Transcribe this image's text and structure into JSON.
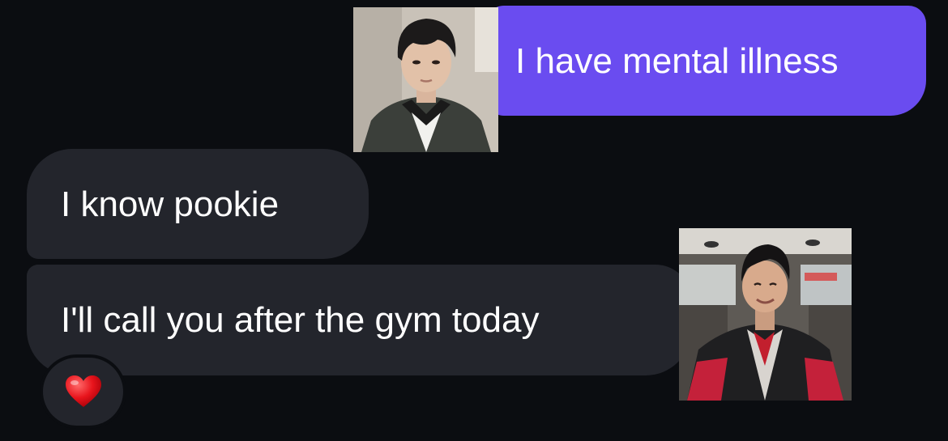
{
  "messages": [
    {
      "direction": "outgoing",
      "text": "I have mental illness"
    },
    {
      "direction": "incoming",
      "text": "I know pookie"
    },
    {
      "direction": "incoming",
      "text": "I'll call you after the gym today"
    }
  ],
  "reaction": {
    "icon": "heart-icon",
    "color": "#e8141c"
  },
  "stickers": [
    {
      "name": "photo-sticker-boy-school-uniform"
    },
    {
      "name": "photo-sticker-smiling-man-car"
    }
  ],
  "colors": {
    "background": "#0b0d11",
    "outgoing_bubble": "#6a4cf0",
    "incoming_bubble": "#23252c",
    "text": "#ffffff"
  }
}
